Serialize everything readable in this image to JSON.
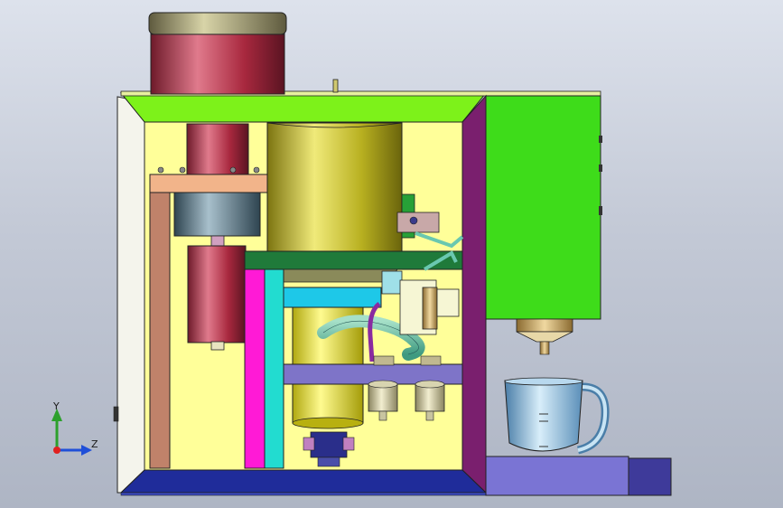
{
  "viewport": {
    "background": [
      "#dde2ec",
      "#aeb5c4"
    ],
    "model": "coffee-machine-assembly"
  },
  "triad": {
    "y_label": "Y",
    "z_label": "Z",
    "colors": {
      "y": "#2ca02c",
      "z": "#1f4fd8",
      "origin": "#e02020"
    }
  },
  "parts": {
    "motor_cap": "#8a8662",
    "motor_body": "#b8344a",
    "housing_top": "#7df21a",
    "housing_inner": "#ffff99",
    "side_panel": "#7a1f6e",
    "front_panel": "#3edc1a",
    "base_plate": "#7a74d4",
    "boiler": "#c8c018",
    "water_tray": "#6a66c8",
    "cup": "#8ec6ea"
  }
}
